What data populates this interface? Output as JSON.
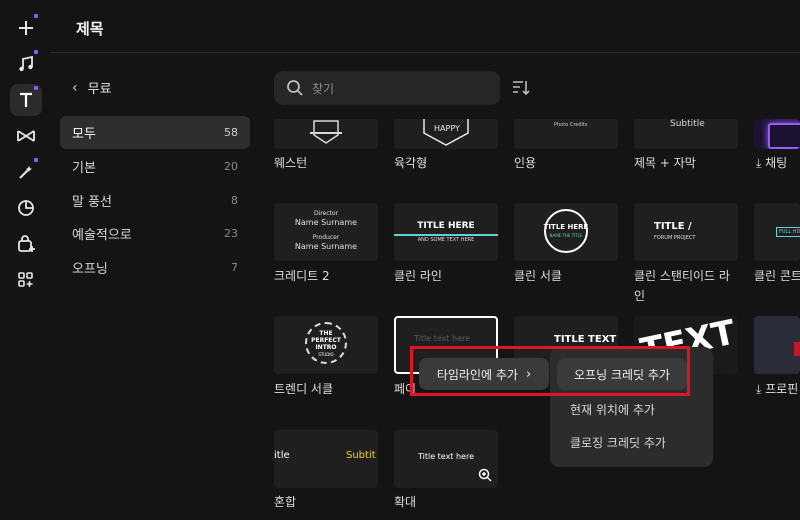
{
  "header": {
    "title": "제목"
  },
  "rail": {
    "items": [
      {
        "icon": "plus-icon"
      },
      {
        "icon": "music-note-icon"
      },
      {
        "icon": "text-icon"
      },
      {
        "icon": "transition-icon"
      },
      {
        "icon": "effects-icon"
      },
      {
        "icon": "sticker-icon"
      },
      {
        "icon": "bag-plus-icon"
      },
      {
        "icon": "apps-plus-icon"
      }
    ]
  },
  "sidebar": {
    "back_label": "무료",
    "categories": [
      {
        "label": "모두",
        "count": "58"
      },
      {
        "label": "기본",
        "count": "20"
      },
      {
        "label": "말 풍선",
        "count": "8"
      },
      {
        "label": "예술적으로",
        "count": "23"
      },
      {
        "label": "오프닝",
        "count": "7"
      }
    ]
  },
  "search": {
    "placeholder": "찾기"
  },
  "grid": {
    "row1": [
      "웨스턴",
      "육각형",
      "인용",
      "제목 + 자막",
      "채팅"
    ],
    "row2": [
      "크레디트 2",
      "클린 라인",
      "클린 서클",
      "클린 스탠티이드 라인",
      "클린 콘트"
    ],
    "row3": [
      "트렌디 서클",
      "페이",
      "",
      "",
      "프로핀"
    ],
    "row4": [
      "혼합",
      "확대"
    ],
    "thumbs": {
      "hexagon": "HAPPY",
      "quote_caption": "Photo Credits",
      "subtitle": "Subtitle",
      "credits_role1": "Director",
      "credits_name1": "Name Surname",
      "credits_role2": "Producer",
      "credits_name2": "Name Surname",
      "clean_line_title": "TITLE HERE",
      "clean_line_sub": "AND SOME TEXT HERE",
      "circle_title": "TITLE HERE",
      "circle_sub": "NAME THE TITLE",
      "standing_title": "TITLE /",
      "standing_sub": "FORUM PROJECT",
      "contrast_text": "FULL HD",
      "trendy_l1": "THE",
      "trendy_l2": "PERFECT",
      "trendy_l3": "INTRO",
      "trendy_l4": "STUDIO",
      "fade_text": "Title text here",
      "third_title": "TITLE TEXT II",
      "big_text": "TEXT",
      "mix_left": "itle",
      "mix_right": "Subtit",
      "zoom_text": "Title text here"
    }
  },
  "context_menu": {
    "add_to_timeline": "타임라인에 추가",
    "opening_credits": "오프닝 크레딧 추가",
    "at_current_position": "현재 위치에 추가",
    "closing_credits": "클로징 크레딧 추가"
  },
  "colors": {
    "accent": "#8b5cf6",
    "highlight": "#e01424",
    "yellow": "#f2d21b"
  }
}
